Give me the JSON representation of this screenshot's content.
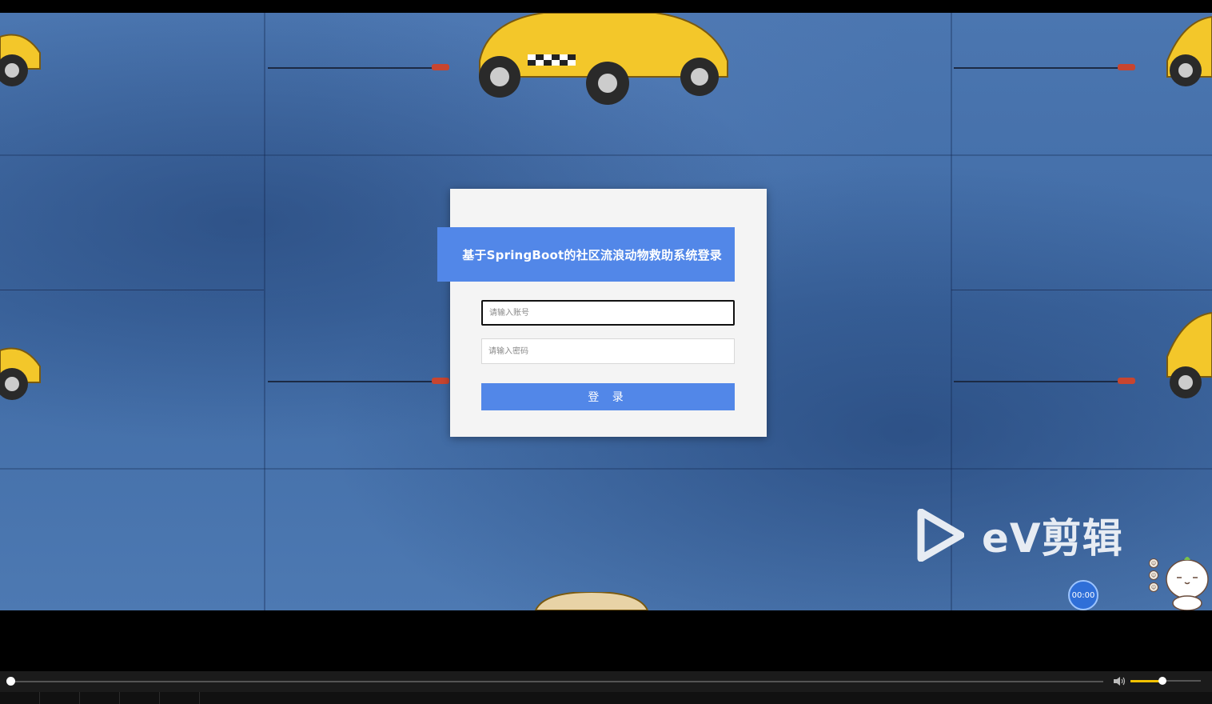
{
  "login": {
    "title": "基于SpringBoot的社区流浪动物救助系统登录",
    "account_placeholder": "请输入账号",
    "password_placeholder": "请输入密码",
    "login_label": "登 录"
  },
  "overlay": {
    "logo_text": "eV剪辑",
    "timer": "00:00"
  },
  "player": {
    "progress": 0.0,
    "volume": 0.45
  },
  "colors": {
    "accent": "#5287e8",
    "card": "#f4f4f4",
    "volume": "#f2c200"
  },
  "icons": [
    "play-icon",
    "volume-icon",
    "car-icon",
    "mascot-icon"
  ]
}
